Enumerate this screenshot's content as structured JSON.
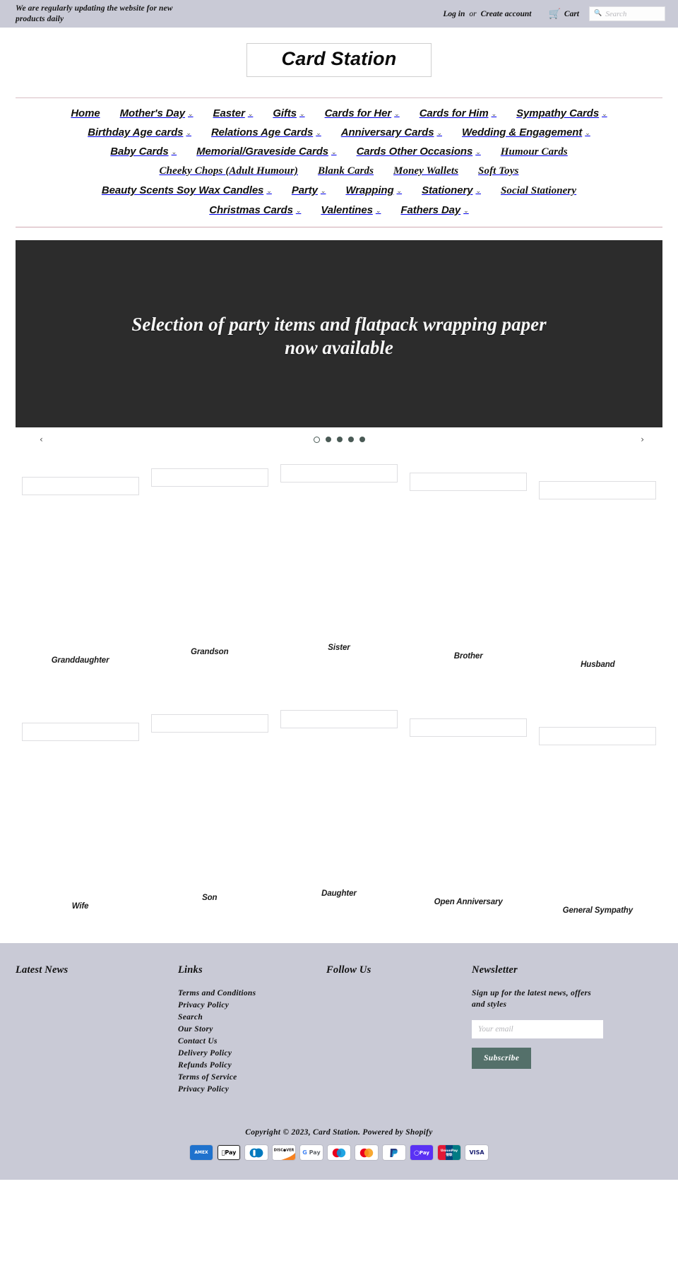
{
  "announcement": {
    "text": "We are regularly updating the website for new products daily"
  },
  "utility": {
    "login": "Log in",
    "or": "or",
    "create_account": "Create account",
    "cart_label": "Cart",
    "cart_icon": "cart-icon",
    "search_icon": "search-icon",
    "search_placeholder": "Search",
    "search_value": ""
  },
  "logo": {
    "text": "Card Station"
  },
  "nav": {
    "caret": "⌄",
    "rows": [
      [
        {
          "label": "Home",
          "caret": false
        },
        {
          "label": "Mother's Day",
          "caret": true
        },
        {
          "label": "Easter",
          "caret": true
        },
        {
          "label": "Gifts",
          "caret": true
        },
        {
          "label": "Cards for Her",
          "caret": true
        },
        {
          "label": "Cards for Him",
          "caret": true
        },
        {
          "label": "Sympathy Cards",
          "caret": true
        }
      ],
      [
        {
          "label": "Birthday Age cards",
          "caret": true
        },
        {
          "label": "Relations Age Cards",
          "caret": true
        },
        {
          "label": "Anniversary Cards",
          "caret": true
        },
        {
          "label": "Wedding & Engagement",
          "caret": true
        }
      ],
      [
        {
          "label": "Baby Cards",
          "caret": true
        },
        {
          "label": "Memorial/Graveside Cards",
          "caret": true
        },
        {
          "label": "Cards Other Occasions",
          "caret": true
        },
        {
          "label": "Humour Cards",
          "caret": false
        }
      ],
      [
        {
          "label": "Cheeky Chops (Adult Humour)",
          "caret": false
        },
        {
          "label": "Blank Cards",
          "caret": false
        },
        {
          "label": "Money Wallets",
          "caret": false
        },
        {
          "label": "Soft Toys",
          "caret": false
        }
      ],
      [
        {
          "label": "Beauty Scents Soy Wax Candles",
          "caret": true
        },
        {
          "label": "Party",
          "caret": true
        },
        {
          "label": "Wrapping",
          "caret": true
        },
        {
          "label": "Stationery",
          "caret": true
        },
        {
          "label": "Social Stationery",
          "caret": false
        }
      ],
      [
        {
          "label": "Christmas Cards",
          "caret": true
        },
        {
          "label": "Valentines",
          "caret": true
        },
        {
          "label": "Fathers Day",
          "caret": true
        }
      ]
    ]
  },
  "hero": {
    "heading": "Selection of party items and flatpack wrapping paper now available",
    "prev_icon": "chevron-left-icon",
    "next_icon": "chevron-right-icon",
    "prev_glyph": "‹",
    "next_glyph": "›",
    "slide_count": 5,
    "active_slide": 1,
    "dot_color": "#4a5a55"
  },
  "collections": {
    "rows": [
      [
        {
          "title": "Granddaughter"
        },
        {
          "title": "Grandson"
        },
        {
          "title": "Sister"
        },
        {
          "title": "Brother"
        },
        {
          "title": "Husband"
        }
      ],
      [
        {
          "title": "Wife"
        },
        {
          "title": "Son"
        },
        {
          "title": "Daughter"
        },
        {
          "title": "Open Anniversary"
        },
        {
          "title": "General Sympathy"
        }
      ]
    ]
  },
  "footer": {
    "latest_news_title": "Latest News",
    "links_title": "Links",
    "links": [
      "Terms and Conditions",
      "Privacy Policy",
      "Search",
      "Our Story",
      "Contact Us",
      "Delivery Policy",
      "Refunds Policy",
      "Terms of Service",
      "Privacy Policy"
    ],
    "follow_title": "Follow Us",
    "newsletter_title": "Newsletter",
    "newsletter_text": "Sign up for the latest news, offers and styles",
    "email_placeholder": "Your email",
    "email_value": "",
    "subscribe_label": "Subscribe",
    "subscribe_color": "#54706a",
    "copyright": "Copyright © 2023, Card Station. Powered by Shopify",
    "payment_icons": [
      "amex-icon",
      "apple-pay-icon",
      "diners-club-icon",
      "discover-icon",
      "google-pay-icon",
      "maestro-icon",
      "mastercard-icon",
      "paypal-icon",
      "shop-pay-icon",
      "union-pay-icon",
      "visa-icon"
    ],
    "payment_labels": [
      "AMEX",
      "Pay",
      "",
      "DISCOVER",
      "Pay",
      "",
      "",
      "",
      "Pay",
      "UnionPay",
      "VISA"
    ],
    "background": "#c9cad6"
  }
}
